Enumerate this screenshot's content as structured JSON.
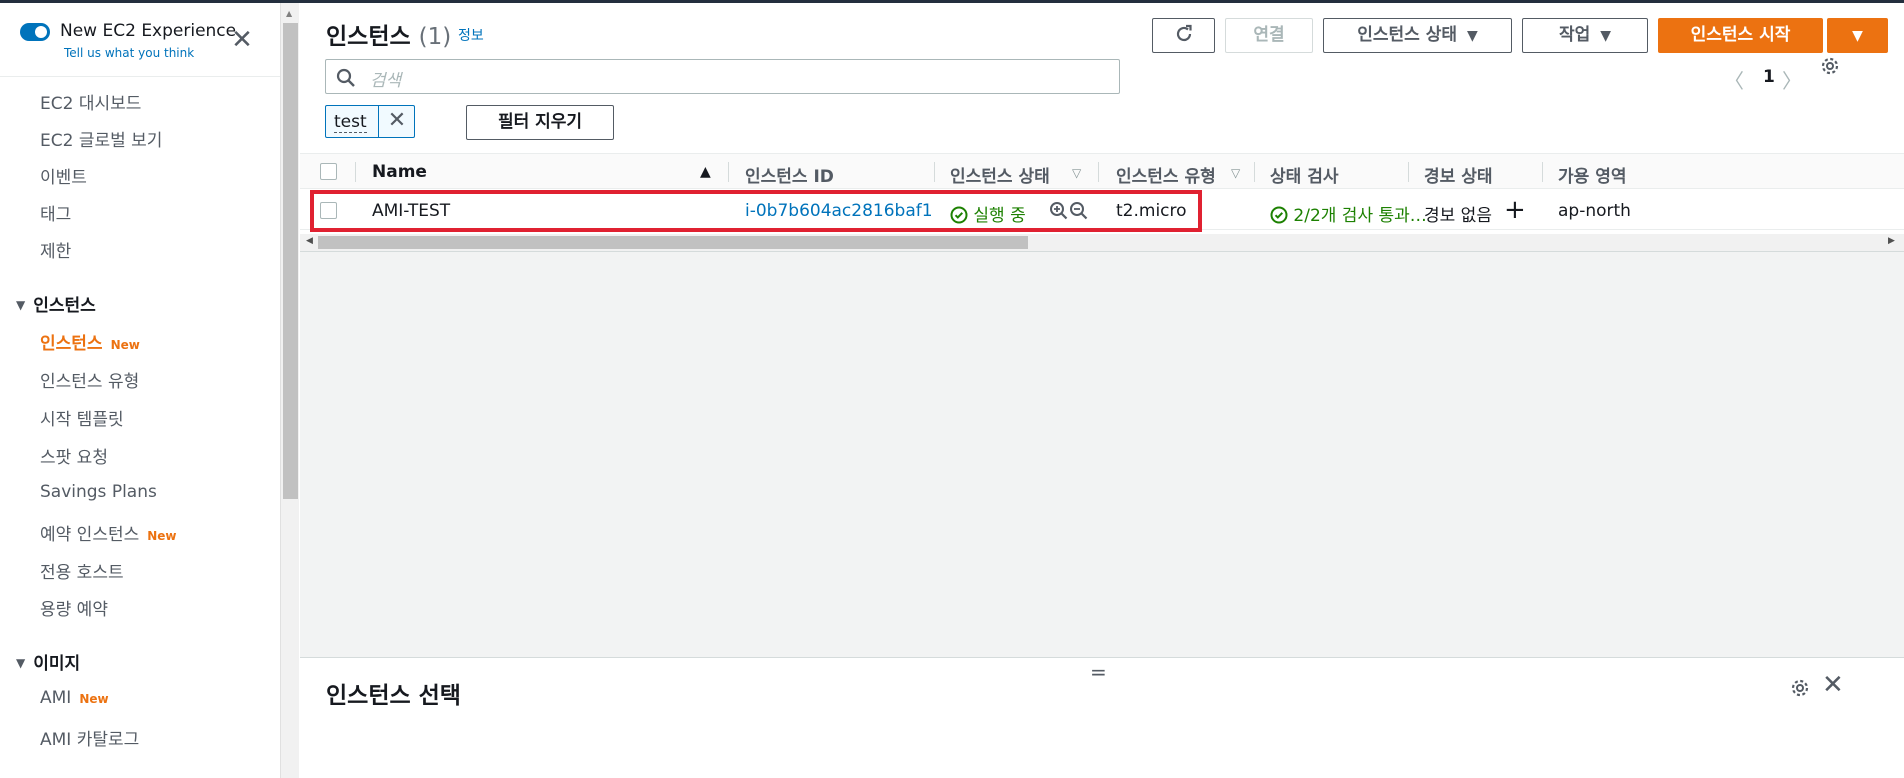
{
  "sidebar": {
    "experience_title": "New EC2 Experience",
    "experience_subtitle": "Tell us what you think",
    "items": [
      {
        "label": "EC2 대시보드"
      },
      {
        "label": "EC2 글로벌 보기"
      },
      {
        "label": "이벤트"
      },
      {
        "label": "태그"
      },
      {
        "label": "제한"
      }
    ],
    "section_instances": {
      "title": "인스턴스",
      "items": [
        {
          "label": "인스턴스",
          "badge": "New",
          "active": true
        },
        {
          "label": "인스턴스 유형"
        },
        {
          "label": "시작 템플릿"
        },
        {
          "label": "스팟 요청"
        },
        {
          "label": "Savings Plans"
        },
        {
          "label": "예약 인스턴스",
          "badge": "New"
        },
        {
          "label": "전용 호스트"
        },
        {
          "label": "용량 예약"
        }
      ]
    },
    "section_images": {
      "title": "이미지",
      "items": [
        {
          "label": "AMI",
          "badge": "New"
        },
        {
          "label": "AMI 카탈로그"
        }
      ]
    }
  },
  "header": {
    "title": "인스턴스",
    "count": "(1)",
    "info_link": "정보",
    "buttons": {
      "connect": "연결",
      "instance_state": "인스턴스 상태",
      "actions": "작업",
      "launch": "인스턴스 시작"
    }
  },
  "search": {
    "placeholder": "검색"
  },
  "pagination": {
    "current_page": "1"
  },
  "filter": {
    "token": "test",
    "clear_label": "필터 지우기"
  },
  "table": {
    "columns": [
      "Name",
      "인스턴스 ID",
      "인스턴스 상태",
      "인스턴스 유형",
      "상태 검사",
      "경보 상태",
      "가용 영역"
    ],
    "rows": [
      {
        "name": "AMI-TEST",
        "instance_id": "i-0b7b604ac2816baf1",
        "state": "실행 중",
        "type": "t2.micro",
        "status_check": "2/2개 검사 통과…",
        "alarm": "경보 없음",
        "az": "ap-north"
      }
    ]
  },
  "bottom_panel": {
    "title": "인스턴스 선택"
  },
  "colors": {
    "accent": "#ec7211",
    "link": "#0073bb",
    "success": "#1d8102",
    "highlight": "#e02131"
  }
}
